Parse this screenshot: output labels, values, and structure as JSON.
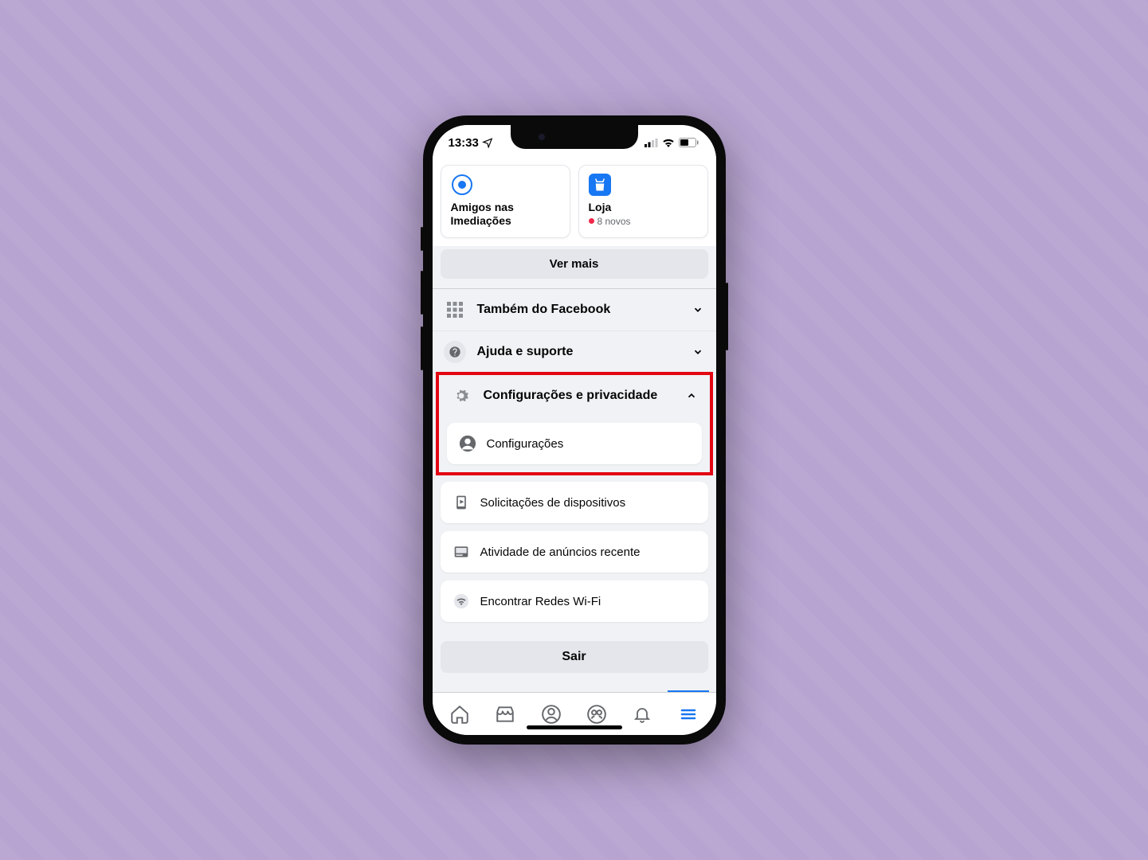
{
  "status": {
    "time": "13:33"
  },
  "shortcuts": {
    "nearby": {
      "label": "Amigos nas Imediações"
    },
    "shop": {
      "label": "Loja",
      "badge": "8 novos"
    }
  },
  "ver_mais": "Ver mais",
  "accordion": {
    "also_fb": "Também do Facebook",
    "help": "Ajuda e suporte",
    "settings_privacy": "Configurações e privacidade"
  },
  "sub_items": {
    "settings": "Configurações",
    "device_requests": "Solicitações de dispositivos",
    "ad_activity": "Atividade de anúncios recente",
    "wifi": "Encontrar Redes Wi-Fi"
  },
  "logout": "Sair"
}
